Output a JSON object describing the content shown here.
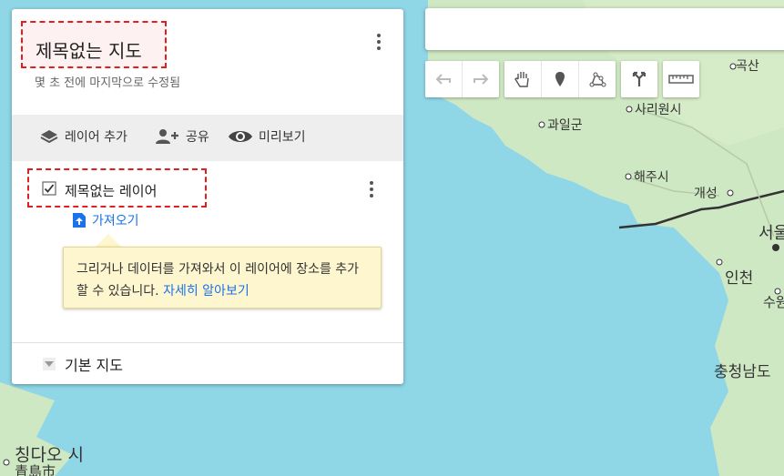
{
  "map": {
    "labels": {
      "gaksan": "곡산",
      "sariwon": "사리원시",
      "gwail": "과일군",
      "haeju": "해주시",
      "gaeseong": "개성",
      "seoul": "서울",
      "incheon": "인천",
      "suwon": "수원",
      "chungnam": "충청남도",
      "qingdao": "칭다오 시",
      "qingdao_cn": "青島市"
    }
  },
  "panel": {
    "title": "제목없는 지도",
    "subtitle": "몇 초 전에 마지막으로 수정됨",
    "actions": {
      "add_layer": "레이어 추가",
      "share": "공유",
      "preview": "미리보기"
    },
    "layer": {
      "name": "제목없는 레이어",
      "checked": true,
      "import_label": "가져오기"
    },
    "tip": {
      "text": "그리거나 데이터를 가져와서 이 레이어에 장소를 추가할 수 있습니다.",
      "link": "자세히 알아보기"
    },
    "basemap_label": "기본 지도"
  },
  "toolbar": {
    "icons": [
      "undo-icon",
      "redo-icon",
      "hand-icon",
      "marker-icon",
      "line-icon",
      "directions-icon",
      "ruler-icon"
    ]
  },
  "colors": {
    "accent": "#1a73e8",
    "highlight": "#e02020",
    "tip_bg": "#fef6cf"
  }
}
